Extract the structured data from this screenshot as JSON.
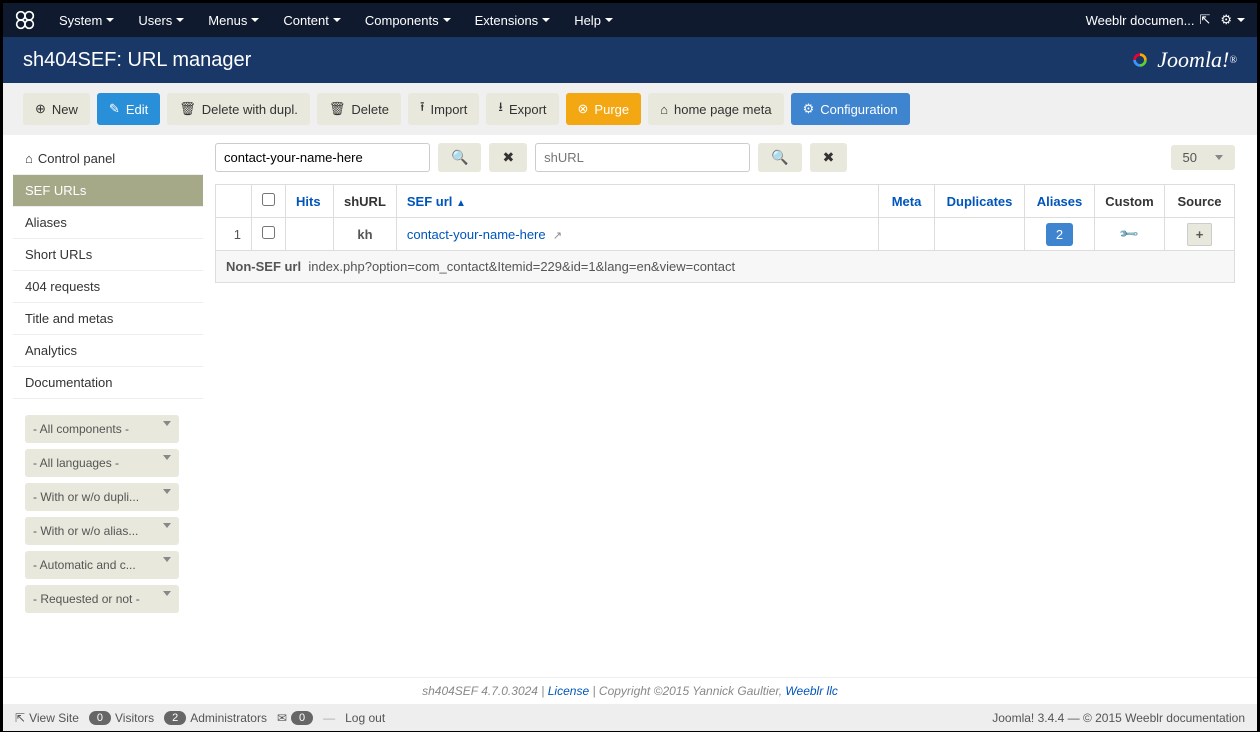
{
  "topnav": {
    "items": [
      "System",
      "Users",
      "Menus",
      "Content",
      "Components",
      "Extensions",
      "Help"
    ],
    "right_link": "Weeblr documen..."
  },
  "header": {
    "title": "sh404SEF: URL manager",
    "brand": "Joomla!"
  },
  "toolbar": {
    "new_label": "New",
    "edit_label": "Edit",
    "delete_dupl": "Delete with dupl.",
    "delete_label": "Delete",
    "import_label": "Import",
    "export_label": "Export",
    "purge_label": "Purge",
    "home_meta": "home page meta",
    "config": "Configuration"
  },
  "sidebar": {
    "items": [
      "Control panel",
      "SEF URLs",
      "Aliases",
      "Short URLs",
      "404 requests",
      "Title and metas",
      "Analytics",
      "Documentation"
    ],
    "filters": [
      "- All components -",
      "- All languages -",
      "- With or w/o dupli...",
      "- With or w/o alias...",
      "- Automatic and c...",
      "- Requested or not -"
    ]
  },
  "search": {
    "value1": "contact-your-name-here",
    "placeholder2": "shURL"
  },
  "pagesize": "50",
  "table": {
    "headers": {
      "hits": "Hits",
      "shurl": "shURL",
      "sefurl": "SEF url",
      "meta": "Meta",
      "duplicates": "Duplicates",
      "aliases": "Aliases",
      "custom": "Custom",
      "source": "Source"
    },
    "row": {
      "num": "1",
      "hits": "",
      "shurl": "kh",
      "sefurl": "contact-your-name-here",
      "aliases_count": "2",
      "source": "+"
    },
    "nonsef_label": "Non-SEF url",
    "nonsef_value": "index.php?option=com_contact&Itemid=229&id=1&lang=en&view=contact"
  },
  "footer_version": {
    "prefix": "sh404SEF 4.7.0.3024 | ",
    "license": "License",
    "middle": " | Copyright ©2015 Yannick Gaultier, ",
    "weeblr": "Weeblr llc"
  },
  "statusbar": {
    "view_site": "View Site",
    "visitors_count": "0",
    "visitors_label": "Visitors",
    "admins_count": "2",
    "admins_label": "Administrators",
    "msg_count": "0",
    "logout": "Log out",
    "right": "Joomla! 3.4.4 — © 2015 Weeblr documentation"
  }
}
